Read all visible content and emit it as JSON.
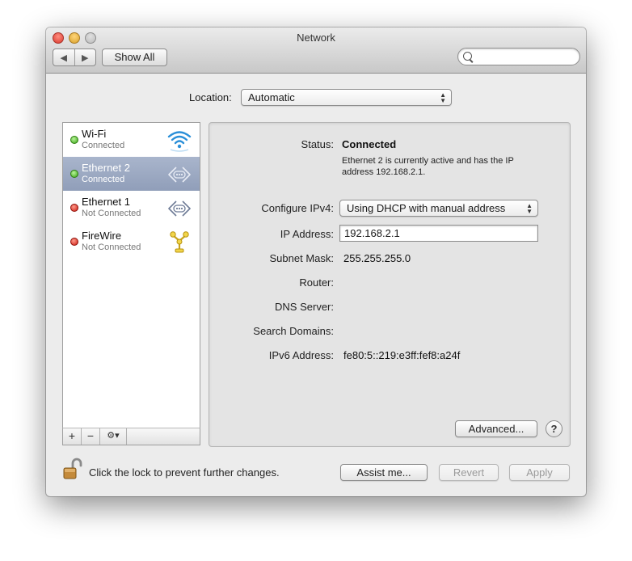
{
  "window": {
    "title": "Network",
    "toolbar": {
      "back_glyph": "◀",
      "forward_glyph": "▶",
      "show_all_label": "Show All",
      "search_placeholder": ""
    }
  },
  "location": {
    "label": "Location:",
    "value": "Automatic"
  },
  "services": [
    {
      "name": "Wi-Fi",
      "status": "Connected",
      "dot_color": "green",
      "icon": "wifi-icon",
      "selected": false
    },
    {
      "name": "Ethernet 2",
      "status": "Connected",
      "dot_color": "green",
      "icon": "ethernet-icon",
      "selected": true
    },
    {
      "name": "Ethernet 1",
      "status": "Not Connected",
      "dot_color": "red",
      "icon": "ethernet-icon",
      "selected": false
    },
    {
      "name": "FireWire",
      "status": "Not Connected",
      "dot_color": "red",
      "icon": "firewire-icon",
      "selected": false
    }
  ],
  "list_toolbar": {
    "add_glyph": "+",
    "remove_glyph": "−",
    "gear_glyph": "⚙▾"
  },
  "details": {
    "status_label": "Status:",
    "status_value": "Connected",
    "status_description": "Ethernet 2 is currently active and has the IP address 192.168.2.1.",
    "configure_label": "Configure IPv4:",
    "configure_value": "Using DHCP with manual address",
    "ip_label": "IP Address:",
    "ip_value": "192.168.2.1",
    "subnet_label": "Subnet Mask:",
    "subnet_value": "255.255.255.0",
    "router_label": "Router:",
    "router_value": "",
    "dns_label": "DNS Server:",
    "dns_value": "",
    "search_domains_label": "Search Domains:",
    "search_domains_value": "",
    "ipv6_label": "IPv6 Address:",
    "ipv6_value": "fe80:5::219:e3ff:fef8:a24f",
    "advanced_label": "Advanced...",
    "help_label": "?"
  },
  "footer": {
    "lock_text": "Click the lock to prevent further changes.",
    "assist_label": "Assist me...",
    "revert_label": "Revert",
    "apply_label": "Apply"
  },
  "colors": {
    "selection": "#9aa7c2",
    "connected_dot": "#3aa315",
    "disconnected_dot": "#cc1b11",
    "window_bg": "#ececec"
  }
}
